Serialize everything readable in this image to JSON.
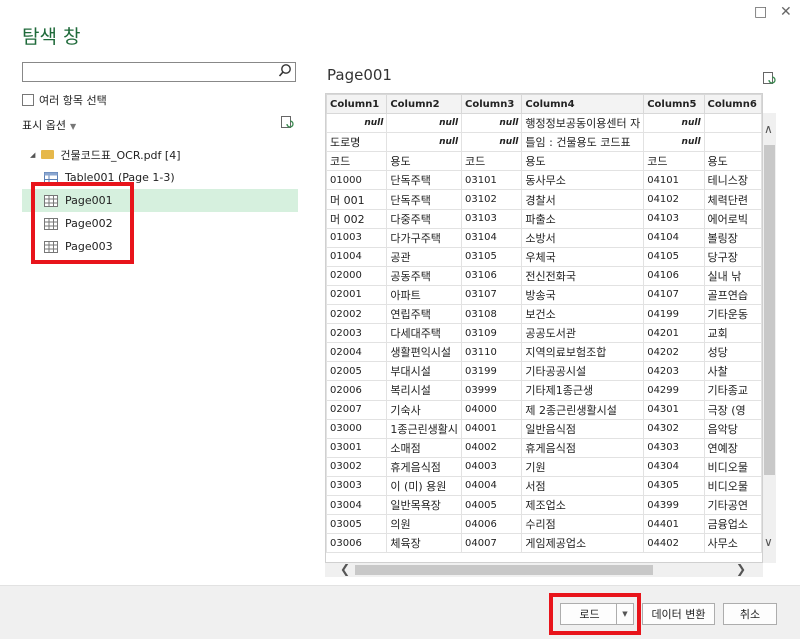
{
  "window": {
    "title": "탐색 창",
    "maximize_glyph": "□",
    "close_glyph": "✕"
  },
  "search": {
    "value": "",
    "placeholder": "",
    "icon": "search-icon"
  },
  "multi_select_label": "여러 항목 선택",
  "display_options_label": "표시 옵션",
  "tree": {
    "file": "건물코드표_OCR.pdf [4]",
    "items": [
      {
        "label": "Table001 (Page 1-3)",
        "icon": "table-icon"
      },
      {
        "label": "Page001",
        "icon": "page-grid-icon",
        "selected": true
      },
      {
        "label": "Page002",
        "icon": "page-grid-icon"
      },
      {
        "label": "Page003",
        "icon": "page-grid-icon"
      }
    ]
  },
  "preview": {
    "title": "Page001",
    "columns": [
      "Column1",
      "Column2",
      "Column3",
      "Column4",
      "Column5",
      "Column6"
    ],
    "rows": [
      [
        "null",
        "null",
        "null",
        "행정정보공동이용센터 자",
        "null",
        ""
      ],
      [
        "도로명",
        "null",
        "null",
        "틀임 : 건물용도 코드표",
        "null",
        ""
      ],
      [
        "코드",
        "용도",
        "코드",
        "용도",
        "코드",
        "용도"
      ],
      [
        "01000",
        "단독주택",
        "03101",
        "동사무소",
        "04101",
        "테니스장"
      ],
      [
        "머 001",
        "단독주택",
        "03102",
        "경찰서",
        "04102",
        "체력단련"
      ],
      [
        "머 002",
        "다중주택",
        "03103",
        "파출소",
        "04103",
        "에어로빅"
      ],
      [
        "01003",
        "다가구주택",
        "03104",
        "소방서",
        "04104",
        "볼링장"
      ],
      [
        "01004",
        "공관",
        "03105",
        "우체국",
        "04105",
        "당구장"
      ],
      [
        "02000",
        "공동주택",
        "03106",
        "전신전화국",
        "04106",
        "실내 낚"
      ],
      [
        "02001",
        "아파트",
        "03107",
        "방송국",
        "04107",
        "골프연습"
      ],
      [
        "02002",
        "연립주택",
        "03108",
        "보건소",
        "04199",
        "기타운동"
      ],
      [
        "02003",
        "다세대주택",
        "03109",
        "공공도서관",
        "04201",
        "교회"
      ],
      [
        "02004",
        "생활편익시설",
        "03110",
        "지역의료보험조합",
        "04202",
        "성당"
      ],
      [
        "02005",
        "부대시설",
        "03199",
        "기타공공시설",
        "04203",
        "사찰"
      ],
      [
        "02006",
        "복리시설",
        "03999",
        "기타제1종근생",
        "04299",
        "기타종교"
      ],
      [
        "02007",
        "기숙사",
        "04000",
        "제 2종근린생활시설",
        "04301",
        "극장 (영"
      ],
      [
        "03000",
        "1종근린생활시",
        "04001",
        "일반음식점",
        "04302",
        "음악당"
      ],
      [
        "03001",
        "소매점",
        "04002",
        "휴게음식점",
        "04303",
        "연예장"
      ],
      [
        "03002",
        "휴게음식점",
        "04003",
        "기원",
        "04304",
        "비디오물"
      ],
      [
        "03003",
        "이 (미) 용원",
        "04004",
        "서점",
        "04305",
        "비디오물"
      ],
      [
        "03004",
        "일반목욕장",
        "04005",
        "제조업소",
        "04399",
        "기타공연"
      ],
      [
        "03005",
        "의원",
        "04006",
        "수리점",
        "04401",
        "금융업소"
      ],
      [
        "03006",
        "체육장",
        "04007",
        "게임제공업소",
        "04402",
        "사무소"
      ]
    ]
  },
  "footer": {
    "load_label": "로드",
    "transform_label": "데이터 변환",
    "cancel_label": "취소"
  },
  "colors": {
    "accent": "#1f6a3a",
    "selected_bg": "#d6f0de",
    "highlight_box": "#e8141b"
  }
}
